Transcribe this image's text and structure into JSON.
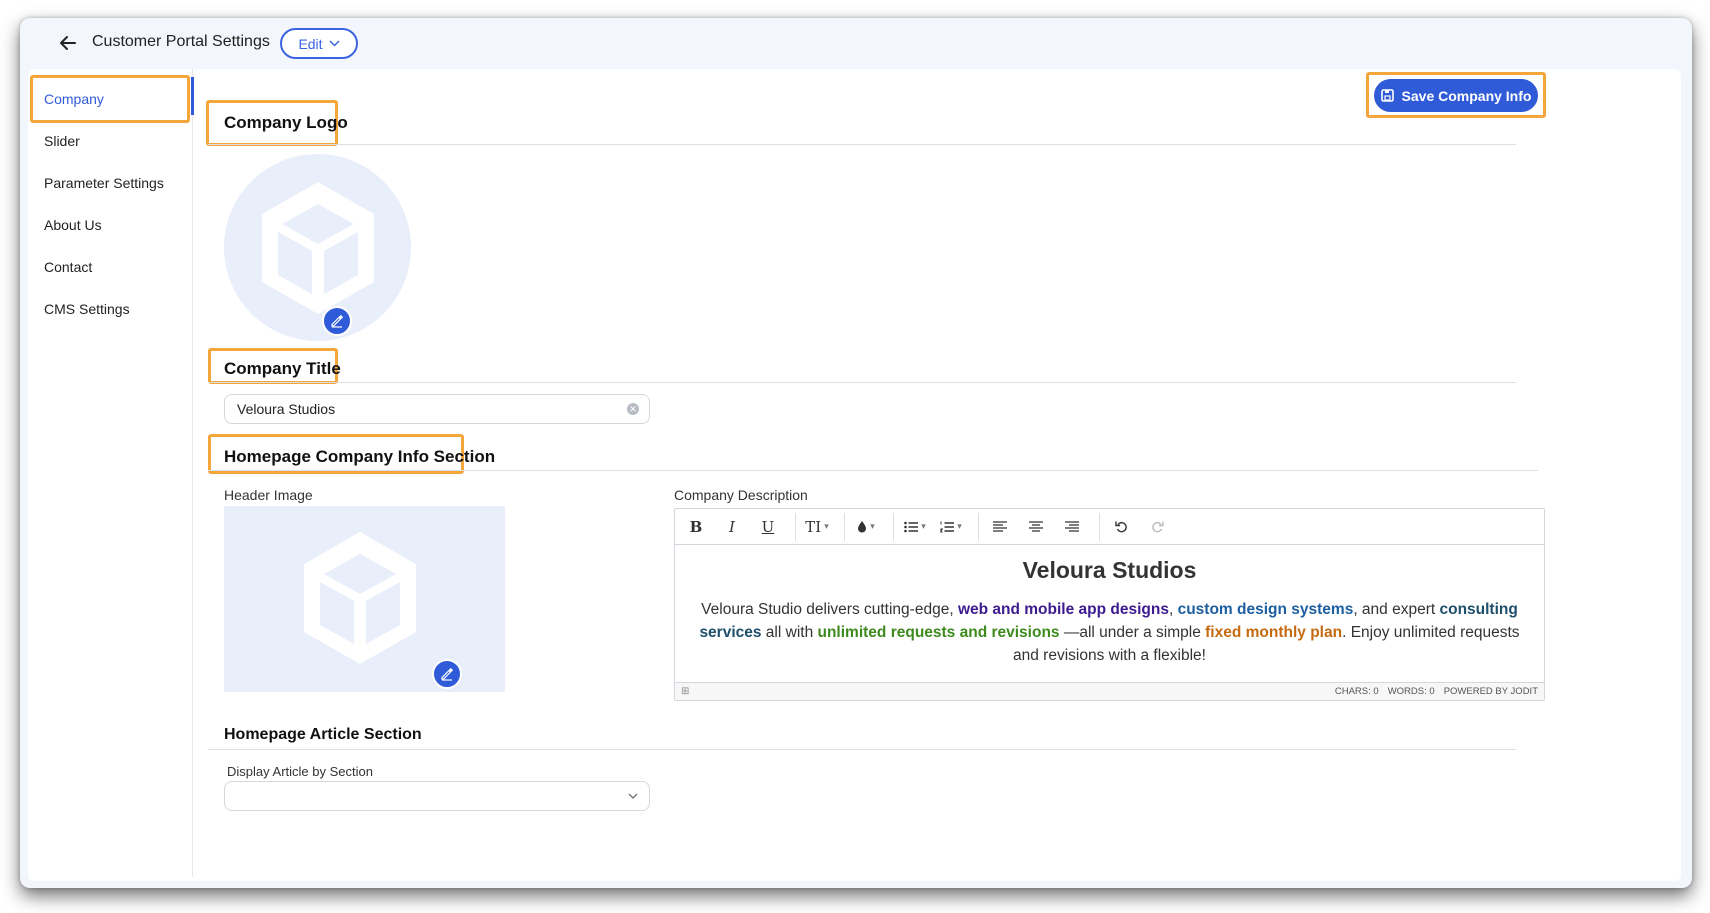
{
  "header": {
    "title": "Customer Portal Settings",
    "edit_label": "Edit"
  },
  "sidebar": {
    "items": [
      {
        "label": "Company",
        "active": true
      },
      {
        "label": "Slider"
      },
      {
        "label": "Parameter Settings"
      },
      {
        "label": "About Us"
      },
      {
        "label": "Contact"
      },
      {
        "label": "CMS Settings"
      }
    ]
  },
  "actions": {
    "save_label": "Save Company Info"
  },
  "company_logo": {
    "title": "Company Logo",
    "icon": "box-placeholder-icon"
  },
  "company_title": {
    "title": "Company Title",
    "value": "Veloura Studios"
  },
  "homepage_info": {
    "title": "Homepage Company Info Section",
    "header_image_label": "Header Image",
    "description_label": "Company Description",
    "editor": {
      "heading": "Veloura Studios",
      "p1": "Veloura Studio delivers cutting-edge, ",
      "h1": "web and mobile app designs",
      "p2": ", ",
      "h2": "custom design systems",
      "p3": ", and expert ",
      "h3": "consulting services",
      "p4": " all with ",
      "h4": "unlimited requests and revisions",
      "p5": " —all under a simple ",
      "h5": "fixed monthly plan",
      "p6": ". Enjoy unlimited requests and revisions with a flexible!",
      "toolbar": {
        "bold": "B",
        "italic": "I",
        "underline": "U",
        "font_size": "TI"
      },
      "status": {
        "chars": "CHARS: 0",
        "words": "WORDS: 0",
        "powered": "POWERED BY JODIT"
      }
    }
  },
  "homepage_article": {
    "title": "Homepage Article Section",
    "select_label": "Display Article by Section",
    "select_value": ""
  },
  "colors": {
    "accent": "#2f5bd9",
    "highlight": "#f5a63a",
    "placeholder_bg": "#e8eefa"
  }
}
